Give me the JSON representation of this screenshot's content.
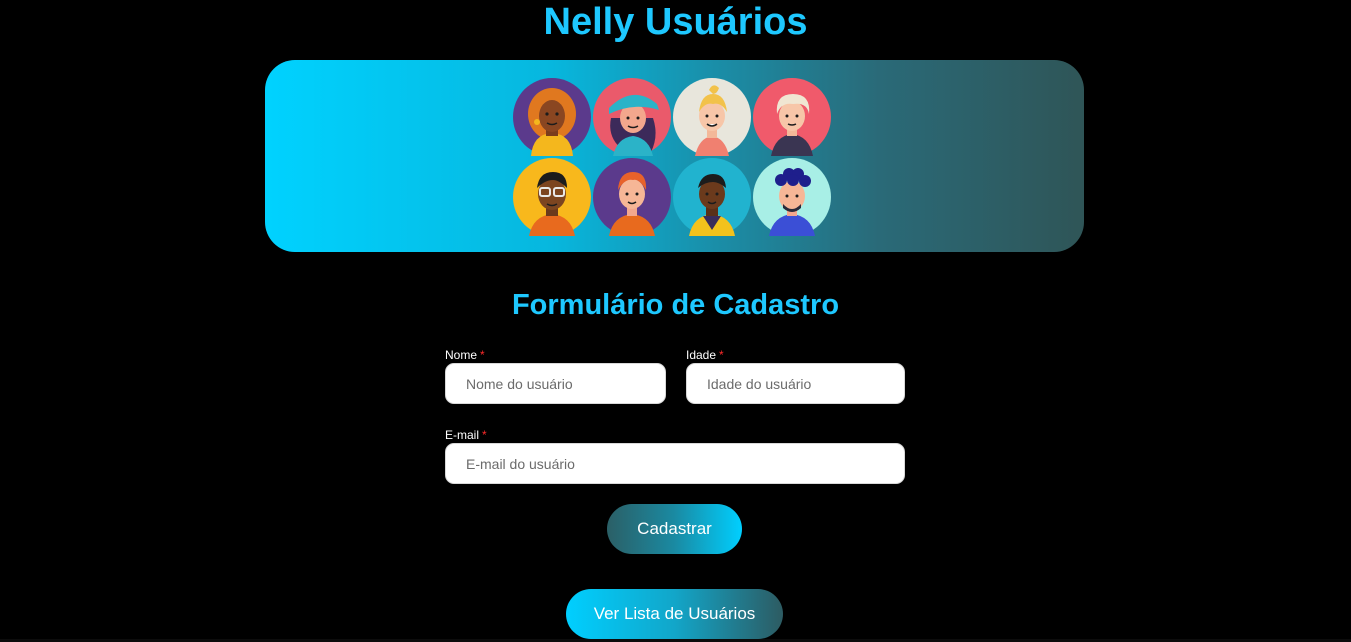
{
  "header": {
    "title": "Nelly Usuários"
  },
  "banner": {
    "avatars": [
      "avatar-woman-curly-hair-icon",
      "avatar-woman-cap-icon",
      "avatar-woman-blonde-icon",
      "avatar-man-white-hair-icon",
      "avatar-man-glasses-icon",
      "avatar-man-red-hair-icon",
      "avatar-man-yellow-jacket-icon",
      "avatar-man-curly-blue-hair-icon"
    ]
  },
  "form": {
    "title": "Formulário de Cadastro",
    "required_mark": "*",
    "name": {
      "label": "Nome",
      "placeholder": "Nome do usuário",
      "value": ""
    },
    "age": {
      "label": "Idade",
      "placeholder": "Idade do usuário",
      "value": ""
    },
    "email": {
      "label": "E-mail",
      "placeholder": "E-mail do usuário",
      "value": ""
    },
    "submit_label": "Cadastrar"
  },
  "actions": {
    "list_users_label": "Ver Lista de Usuários"
  },
  "colors": {
    "title": "#1ec8ff",
    "required": "#ff2a2a",
    "banner_start": "#00d2ff",
    "banner_end": "#2f5557"
  }
}
